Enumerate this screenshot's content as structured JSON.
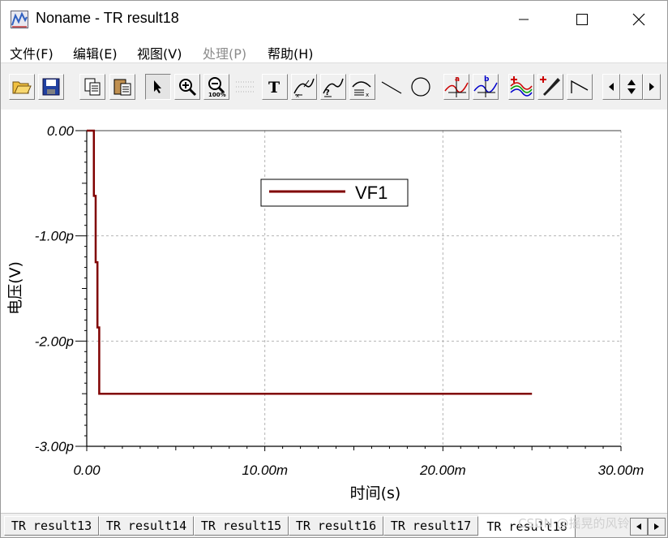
{
  "window": {
    "title": "Noname - TR result18",
    "minimize_glyph": "—",
    "maximize_glyph": "☐",
    "close_glyph": "✕"
  },
  "menu": [
    {
      "label": "文件(F)",
      "enabled": true
    },
    {
      "label": "编辑(E)",
      "enabled": true
    },
    {
      "label": "视图(V)",
      "enabled": true
    },
    {
      "label": "处理(P)",
      "enabled": false
    },
    {
      "label": "帮助(H)",
      "enabled": true
    }
  ],
  "toolbar": {
    "icons": [
      "open-folder-icon",
      "save-icon",
      "copy-icon",
      "paste-icon",
      "pointer-icon",
      "zoom-in-icon",
      "zoom-100-icon",
      "grid-icon",
      "text-icon",
      "cursor-a-icon",
      "cursor-b-icon",
      "wave-label-icon",
      "line-icon",
      "circle-icon",
      "marker-a-icon",
      "marker-b-icon",
      "add-curve-icon",
      "probe-icon",
      "slope-icon",
      "scroll-left-icon",
      "scroll-updown-icon",
      "scroll-right-icon"
    ],
    "accent_red": "#cc0000",
    "accent_blue": "#0000cc"
  },
  "chart_data": {
    "type": "line",
    "title": "",
    "xlabel": "时间(s)",
    "ylabel": "电压(V)",
    "xlim": [
      0,
      0.03
    ],
    "ylim": [
      -3e-12,
      0
    ],
    "x_ticks": [
      {
        "value": 0,
        "label": "0.00"
      },
      {
        "value": 0.01,
        "label": "10.00m"
      },
      {
        "value": 0.02,
        "label": "20.00m"
      },
      {
        "value": 0.03,
        "label": "30.00m"
      }
    ],
    "y_ticks": [
      {
        "value": 0,
        "label": "0.00"
      },
      {
        "value": -1e-12,
        "label": "-1.00p"
      },
      {
        "value": -2e-12,
        "label": "-2.00p"
      },
      {
        "value": -3e-12,
        "label": "-3.00p"
      }
    ],
    "grid": true,
    "legend_position": "top-center",
    "series": [
      {
        "name": "VF1",
        "color": "#800000",
        "x": [
          0,
          0.0004,
          0.0004,
          0.0005,
          0.0005,
          0.0006,
          0.0006,
          0.0007,
          0.0007,
          0.025
        ],
        "y": [
          0,
          0,
          -6.2e-13,
          -6.2e-13,
          -1.25e-12,
          -1.25e-12,
          -1.87e-12,
          -1.87e-12,
          -2.5e-12,
          -2.5e-12
        ]
      }
    ]
  },
  "tabs": [
    {
      "label": "TR result13",
      "active": false
    },
    {
      "label": "TR result14",
      "active": false
    },
    {
      "label": "TR result15",
      "active": false
    },
    {
      "label": "TR result16",
      "active": false
    },
    {
      "label": "TR result17",
      "active": false
    },
    {
      "label": "TR result18",
      "active": true
    }
  ],
  "watermark": "CSDN @摇晃的风铃"
}
